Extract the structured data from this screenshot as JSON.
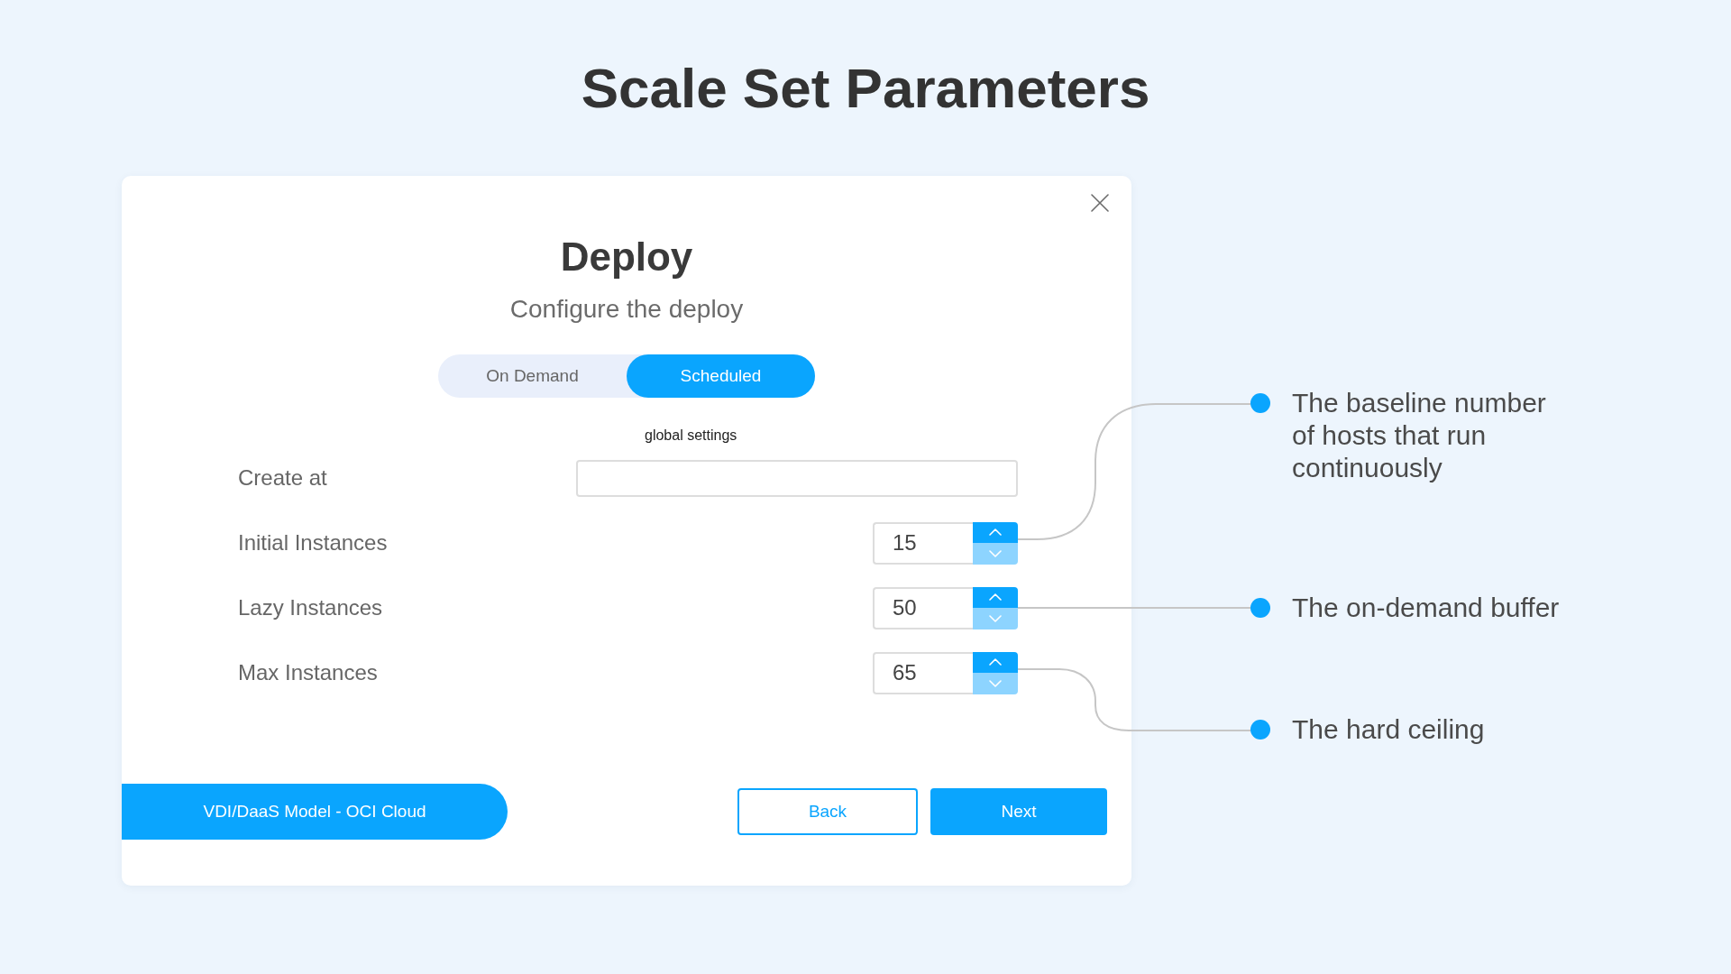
{
  "title": "Scale Set Parameters",
  "dialog": {
    "title": "Deploy",
    "subtitle": "Configure the deploy",
    "mode_tabs": [
      {
        "label": "On Demand",
        "selected": false
      },
      {
        "label": "Scheduled",
        "selected": true
      }
    ],
    "section_label": "global settings",
    "fields": [
      {
        "kind": "text",
        "label": "Create at"
      },
      {
        "kind": "number",
        "label": "Initial Instances",
        "value": "15"
      },
      {
        "kind": "number",
        "label": "Lazy Instances",
        "value": "50"
      },
      {
        "kind": "number",
        "label": "Max Instances",
        "value": "65"
      }
    ],
    "model_banner": "VDI/DaaS Model - OCI Cloud",
    "buttons": [
      {
        "kind": "secondary",
        "label": "Back"
      },
      {
        "kind": "primary",
        "label": "Next"
      }
    ]
  },
  "callouts": [
    "The baseline number of hosts that run continuously",
    "The on-demand buffer",
    "The hard ceiling"
  ]
}
